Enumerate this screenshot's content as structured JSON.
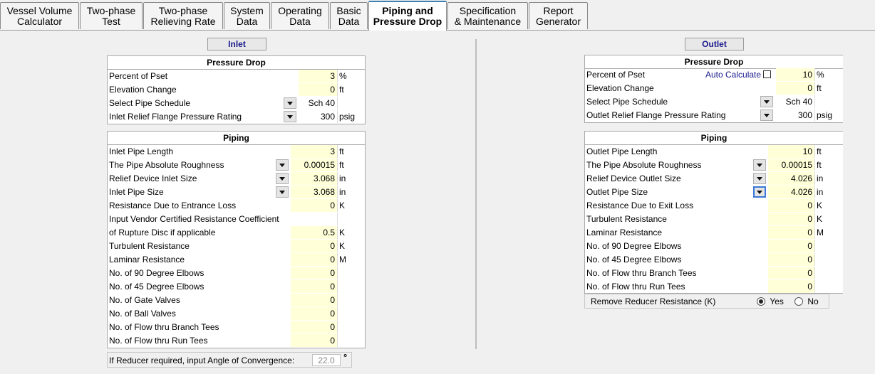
{
  "tabs": [
    {
      "label": "Vessel Volume\nCalculator"
    },
    {
      "label": "Two-phase\nTest"
    },
    {
      "label": "Two-phase\nRelieving Rate"
    },
    {
      "label": "System\nData"
    },
    {
      "label": "Operating\nData"
    },
    {
      "label": "Basic\nData"
    },
    {
      "label": "Piping and\nPressure Drop"
    },
    {
      "label": "Specification\n& Maintenance"
    },
    {
      "label": "Report\nGenerator"
    }
  ],
  "inlet": {
    "section_label": "Inlet",
    "pressure_drop": {
      "title": "Pressure Drop",
      "rows": [
        {
          "label": "Percent of Pset",
          "value": "3",
          "unit": "%"
        },
        {
          "label": "Elevation Change",
          "value": "0",
          "unit": "ft"
        },
        {
          "label": "Select Pipe Schedule",
          "value": "Sch 40",
          "unit": ""
        },
        {
          "label": "Inlet Relief Flange Pressure Rating",
          "value": "300",
          "unit": "psig"
        }
      ]
    },
    "piping": {
      "title": "Piping",
      "rows": [
        {
          "label": "Inlet Pipe Length",
          "value": "3",
          "unit": "ft"
        },
        {
          "label": "The Pipe Absolute Roughness",
          "value": "0.00015",
          "unit": "ft"
        },
        {
          "label": "Relief Device Inlet Size",
          "value": "3.068",
          "unit": "in"
        },
        {
          "label": "Inlet Pipe Size",
          "value": "3.068",
          "unit": "in"
        },
        {
          "label": "Resistance Due to Entrance Loss",
          "value": "0",
          "unit": "K"
        },
        {
          "label": "Input Vendor Certified Resistance Coefficient",
          "value": "",
          "unit": ""
        },
        {
          "label": " of Rupture Disc if applicable",
          "value": "0.5",
          "unit": "K"
        },
        {
          "label": "Turbulent Resistance",
          "value": "0",
          "unit": "K"
        },
        {
          "label": "Laminar Resistance",
          "value": "0",
          "unit": "M"
        },
        {
          "label": "No. of 90 Degree Elbows",
          "value": "0",
          "unit": ""
        },
        {
          "label": "No. of 45 Degree Elbows",
          "value": "0",
          "unit": ""
        },
        {
          "label": "No. of Gate Valves",
          "value": "0",
          "unit": ""
        },
        {
          "label": "No. of Ball Valves",
          "value": "0",
          "unit": ""
        },
        {
          "label": "No. of Flow thru Branch Tees",
          "value": "0",
          "unit": ""
        },
        {
          "label": "No. of Flow thru Run Tees",
          "value": "0",
          "unit": ""
        }
      ]
    },
    "reducer": {
      "label": "If Reducer required, input Angle of Convergence:",
      "value": "22.0",
      "unit": "°"
    }
  },
  "outlet": {
    "section_label": "Outlet",
    "pressure_drop": {
      "title": "Pressure Drop",
      "auto_calculate_label": "Auto Calculate",
      "rows": [
        {
          "label": "Percent of Pset",
          "value": "10",
          "unit": "%"
        },
        {
          "label": "Elevation Change",
          "value": "0",
          "unit": "ft"
        },
        {
          "label": "Select Pipe Schedule",
          "value": "Sch 40",
          "unit": ""
        },
        {
          "label": "Outlet Relief Flange Pressure Rating",
          "value": "300",
          "unit": "psig"
        }
      ]
    },
    "piping": {
      "title": "Piping",
      "rows": [
        {
          "label": "Outlet Pipe Length",
          "value": "10",
          "unit": "ft"
        },
        {
          "label": "The Pipe Absolute Roughness",
          "value": "0.00015",
          "unit": "ft"
        },
        {
          "label": "Relief Device Outlet Size",
          "value": "4.026",
          "unit": "in"
        },
        {
          "label": "Outlet Pipe Size",
          "value": "4.026",
          "unit": "in"
        },
        {
          "label": "Resistance Due to Exit Loss",
          "value": "0",
          "unit": "K"
        },
        {
          "label": "Turbulent Resistance",
          "value": "0",
          "unit": "K"
        },
        {
          "label": "Laminar Resistance",
          "value": "0",
          "unit": "M"
        },
        {
          "label": "No. of 90 Degree Elbows",
          "value": "0",
          "unit": ""
        },
        {
          "label": "No. of 45 Degree Elbows",
          "value": "0",
          "unit": ""
        },
        {
          "label": "No. of Flow thru Branch Tees",
          "value": "0",
          "unit": ""
        },
        {
          "label": "No. of Flow thru Run Tees",
          "value": "0",
          "unit": ""
        }
      ]
    },
    "reducer_resistance": {
      "label": "Remove Reducer Resistance (K)",
      "yes_label": "Yes",
      "no_label": "No",
      "selected": "Yes"
    }
  }
}
